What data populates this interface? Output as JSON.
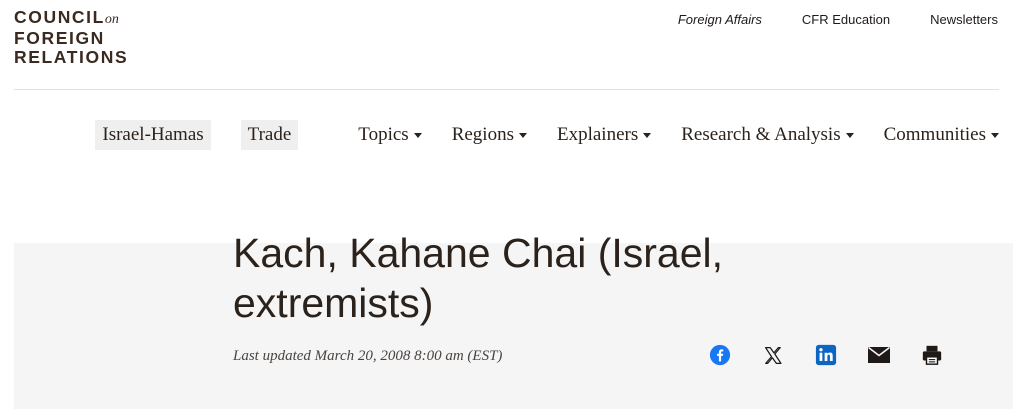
{
  "logo": {
    "line1": "COUNCIL",
    "on": "on",
    "line2": "FOREIGN",
    "line3": "RELATIONS"
  },
  "top_links": [
    "Foreign Affairs",
    "CFR Education",
    "Newsletters"
  ],
  "main_nav": {
    "pills": [
      "Israel-Hamas",
      "Trade"
    ],
    "items": [
      "Topics",
      "Regions",
      "Explainers",
      "Research & Analysis",
      "Communities"
    ]
  },
  "article": {
    "title": "Kach, Kahane Chai (Israel, extremists)",
    "updated": "Last updated March 20, 2008 8:00 am (EST)"
  },
  "share_icons": [
    "facebook-icon",
    "x-icon",
    "linkedin-icon",
    "email-icon",
    "print-icon"
  ],
  "colors": {
    "facebook": "#1877f2",
    "linkedin": "#0a66c2",
    "dark": "#2b221c",
    "hero_bg": "#f5f5f5"
  }
}
